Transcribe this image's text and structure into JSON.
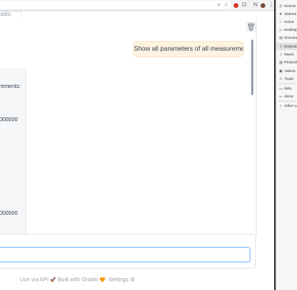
{
  "browser": {
    "toolbar_icons": [
      "search-icon",
      "star-icon",
      "profile-red-icon",
      "extensions-icon",
      "profile-letter-icon",
      "avatar",
      "menu-icon"
    ],
    "glyph_search": "⌕",
    "glyph_star": "☆",
    "glyph_ext": "⊡",
    "glyph_letter": "N",
    "glyph_menu": "⋮"
  },
  "chat": {
    "top_chip_text": "radio.",
    "user_message": "Show all parameters of all measurements.",
    "bot_lines": [
      {
        "text": "rements:"
      },
      {
        "text": "000000"
      },
      {
        "text": "000000"
      }
    ],
    "trash_glyph": "🗑",
    "scroll_down_glyph": "▼"
  },
  "input": {
    "placeholder": ""
  },
  "footer": {
    "use_via_api": "Use via API",
    "api_emoji": "🚀",
    "built_with": "Built with Gradio",
    "gradio_emoji": "🧡",
    "settings": "Settings",
    "settings_glyph": "⚙",
    "separator": "·"
  },
  "file_dialog": {
    "sidebar": {
      "items": [
        {
          "label": "Recent",
          "icon": "clock-icon",
          "glyph": "◷"
        },
        {
          "label": "Starred",
          "icon": "star-icon",
          "glyph": "★"
        },
        {
          "label": "Home",
          "icon": "home-icon",
          "glyph": "⌂"
        },
        {
          "label": "Desktop",
          "icon": "desktop-icon",
          "glyph": "▭"
        },
        {
          "label": "Documents",
          "icon": "document-icon",
          "glyph": "▤"
        },
        {
          "label": "Downloads",
          "icon": "download-icon",
          "glyph": "⇩",
          "active": true
        },
        {
          "label": "Music",
          "icon": "music-icon",
          "glyph": "♫"
        },
        {
          "label": "Pictures",
          "icon": "picture-icon",
          "glyph": "▨"
        },
        {
          "label": "Videos",
          "icon": "video-icon",
          "glyph": "▣"
        },
        {
          "label": "Trash",
          "icon": "trash-icon",
          "glyph": "♲"
        },
        {
          "label": "data",
          "icon": "folder-icon",
          "glyph": "▭"
        },
        {
          "label": "demo",
          "icon": "folder-icon",
          "glyph": "▭"
        },
        {
          "label": "Other Locations",
          "icon": "plus-icon",
          "glyph": "+"
        }
      ]
    }
  }
}
